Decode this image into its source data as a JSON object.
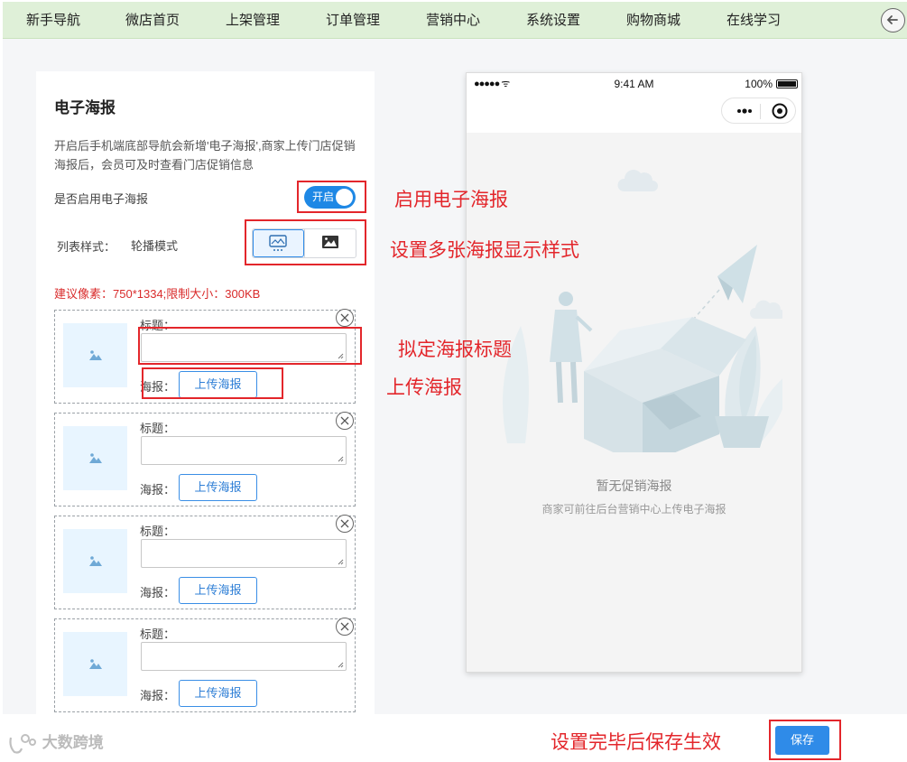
{
  "nav": {
    "items": [
      "新手导航",
      "微店首页",
      "上架管理",
      "订单管理",
      "营销中心",
      "系统设置",
      "购物商城",
      "在线学习"
    ]
  },
  "panel": {
    "title": "电子海报",
    "description": "开启后手机端底部导航会新增'电子海报',商家上传门店促销海报后，会员可及时查看门店促销信息",
    "enable_label": "是否启用电子海报",
    "toggle_text": "开启",
    "list_style_label": "列表样式：",
    "list_style_value": "轮播模式",
    "hint": "建议像素：750*1334;限制大小：300KB",
    "posters": [
      {
        "title_label": "标题：",
        "title_value": "",
        "poster_label": "海报：",
        "upload_label": "上传海报"
      },
      {
        "title_label": "标题：",
        "title_value": "",
        "poster_label": "海报：",
        "upload_label": "上传海报"
      },
      {
        "title_label": "标题：",
        "title_value": "",
        "poster_label": "海报：",
        "upload_label": "上传海报"
      },
      {
        "title_label": "标题：",
        "title_value": "",
        "poster_label": "海报：",
        "upload_label": "上传海报"
      }
    ]
  },
  "phone": {
    "signal": "●●●●● ᯤ",
    "time": "9:41 AM",
    "battery": "100%",
    "empty_title": "暂无促销海报",
    "empty_subtitle": "商家可前往后台营销中心上传电子海报"
  },
  "annotations": {
    "enable": "启用电子海报",
    "style": "设置多张海报显示样式",
    "title": "拟定海报标题",
    "upload": "上传海报",
    "save": "设置完毕后保存生效"
  },
  "footer": {
    "watermark": "大数跨境",
    "save_label": "保存"
  },
  "colors": {
    "accent": "#2f8be8",
    "annotation_red": "#e3262b",
    "nav_bg": "#dff0d8"
  }
}
